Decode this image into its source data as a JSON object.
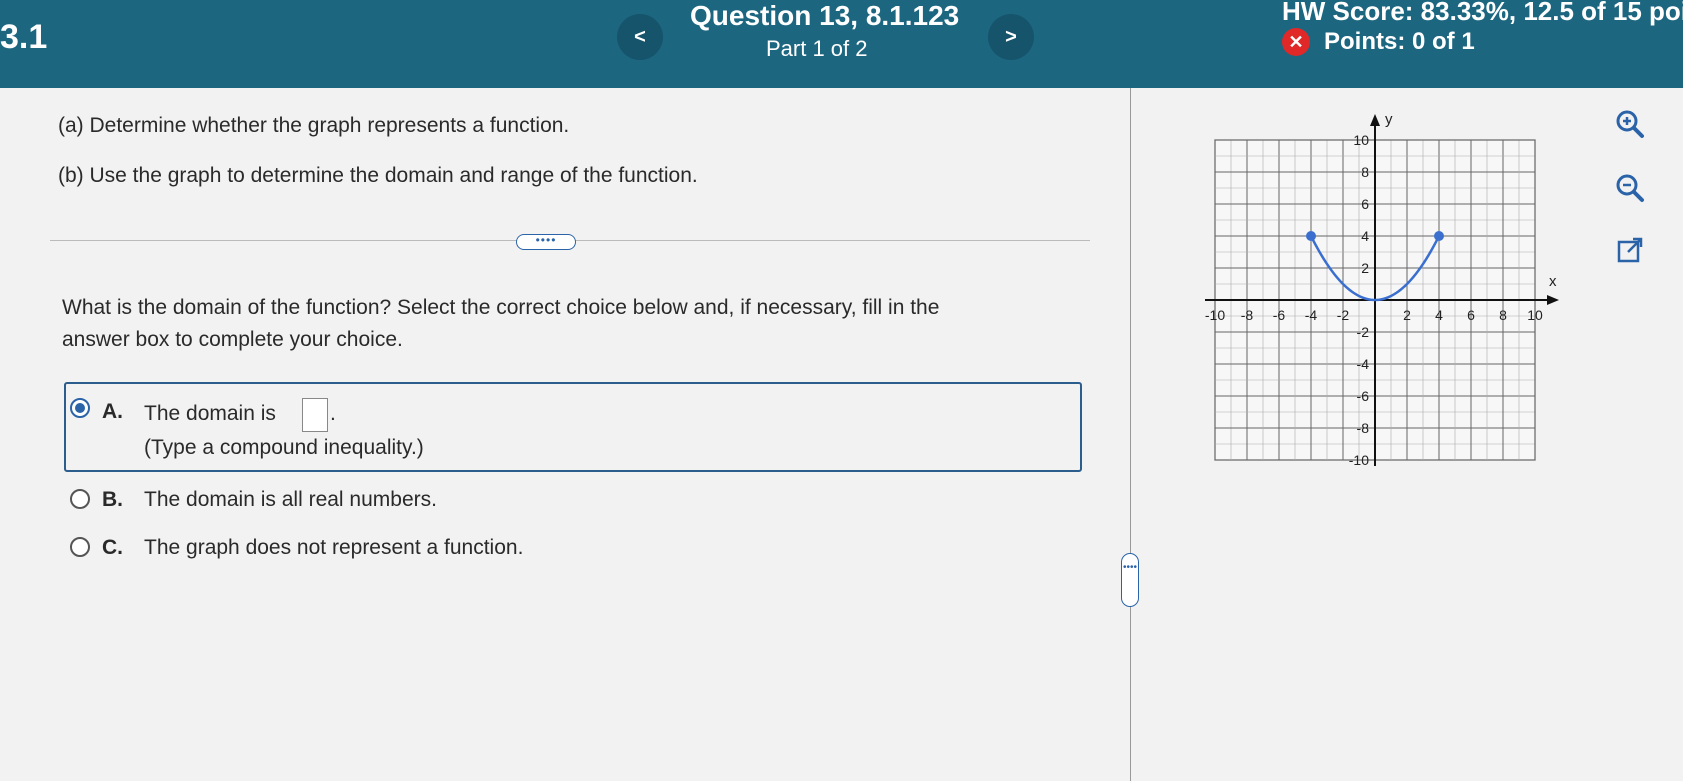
{
  "header": {
    "section": "3.1",
    "prev_label": "<",
    "next_label": ">",
    "question_title": "Question 13, 8.1.123",
    "part": "Part 1 of 2",
    "hw_score": "HW Score: 83.33%, 12.5 of 15 poi",
    "points": "Points: 0 of 1",
    "status_icon": "incorrect-x-icon",
    "status_color": "#e02828"
  },
  "question": {
    "part_a": "(a) Determine whether the graph represents a function.",
    "part_b": "(b) Use the graph to determine the domain and range of the function.",
    "more_label": "••••",
    "prompt_line1": "What is the domain of the function? Select the correct choice below and, if necessary, fill in the",
    "prompt_line2": "answer box to complete your choice."
  },
  "choices": [
    {
      "letter": "A.",
      "text": "The domain is",
      "hint": "(Type a compound inequality.)",
      "selected": true,
      "period": "."
    },
    {
      "letter": "B.",
      "text": "The domain is all real numbers.",
      "selected": false
    },
    {
      "letter": "C.",
      "text": "The graph does not represent a function.",
      "selected": false
    }
  ],
  "graph": {
    "x_label": "x",
    "y_label": "y",
    "x_ticks": [
      "-10",
      "-8",
      "-6",
      "-4",
      "-2",
      "2",
      "4",
      "6",
      "8",
      "10"
    ],
    "y_ticks": [
      "10",
      "8",
      "6",
      "4",
      "2",
      "-2",
      "-4",
      "-6",
      "-8",
      "-10"
    ],
    "xlim": [
      -10,
      10
    ],
    "ylim": [
      -10,
      10
    ],
    "curve_color": "#3a6fd0",
    "points": [
      {
        "x": -4,
        "y": 4
      },
      {
        "x": 4,
        "y": 4
      }
    ],
    "vertex": {
      "x": 0,
      "y": 0
    }
  },
  "tools": {
    "zoom_in": "zoom-in-icon",
    "zoom_out": "zoom-out-icon",
    "open": "open-external-icon"
  },
  "accent": "#2b63a8"
}
